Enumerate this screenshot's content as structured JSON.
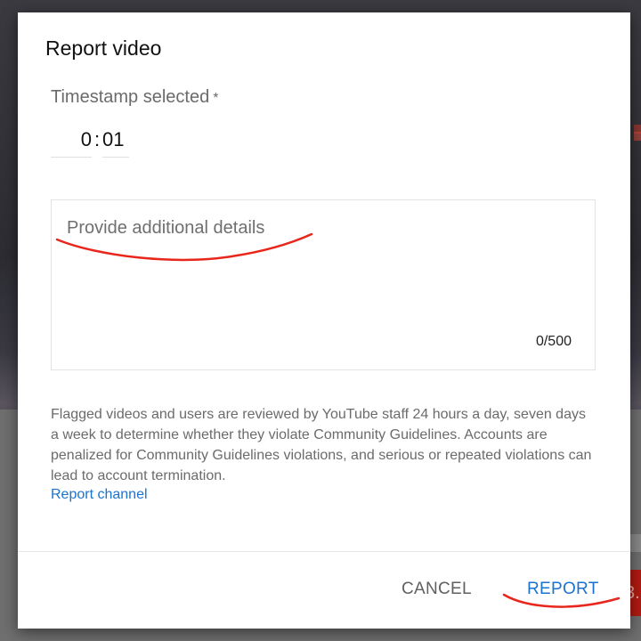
{
  "dialog": {
    "title": "Report video",
    "timestamp": {
      "label": "Timestamp selected",
      "required_mark": "*",
      "minutes": "0",
      "separator": ":",
      "seconds": "01"
    },
    "details": {
      "placeholder": "Provide additional details",
      "counter": "0/500"
    },
    "info_text": "Flagged videos and users are reviewed by YouTube staff 24 hours a day, seven days a week to determine whether they violate Community Guidelines. Accounts are penalized for Community Guidelines violations, and serious or repeated violations can lead to account termination.",
    "report_channel_link": "Report channel",
    "buttons": {
      "cancel": "CANCEL",
      "report": "REPORT"
    }
  },
  "colors": {
    "link_blue": "#1a73d1",
    "annotation_red": "#e8261c",
    "background_red_button": "#b21b12"
  },
  "background": {
    "red_button_fragment": "3."
  }
}
